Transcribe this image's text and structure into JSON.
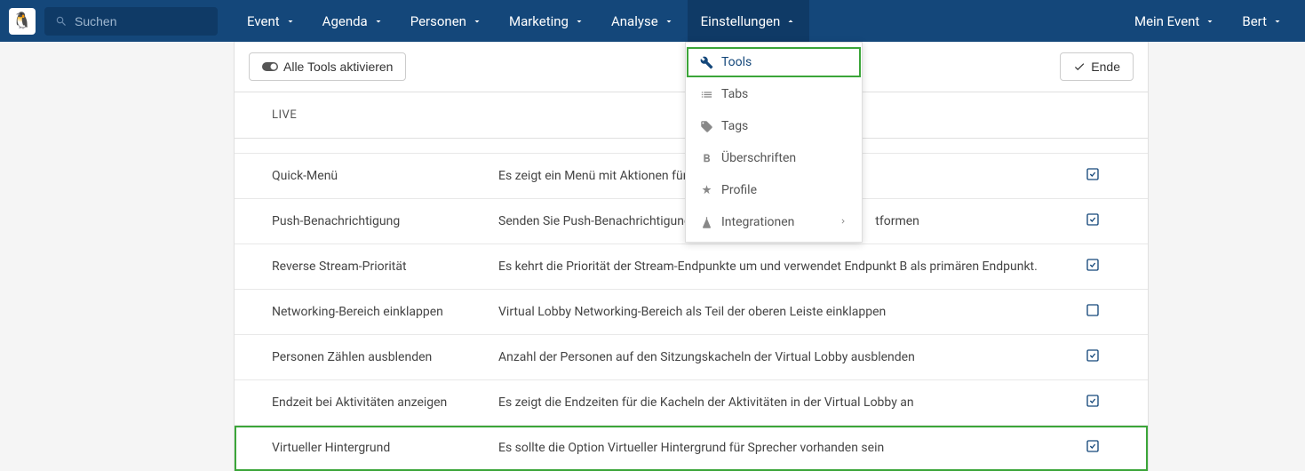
{
  "search": {
    "placeholder": "Suchen"
  },
  "nav": {
    "items": [
      {
        "label": "Event"
      },
      {
        "label": "Agenda"
      },
      {
        "label": "Personen"
      },
      {
        "label": "Marketing"
      },
      {
        "label": "Analyse"
      },
      {
        "label": "Einstellungen"
      }
    ],
    "right": [
      {
        "label": "Mein Event"
      },
      {
        "label": "Bert"
      }
    ]
  },
  "toolbar": {
    "activate_label": "Alle Tools aktivieren",
    "end_label": "Ende"
  },
  "section": {
    "title": "LIVE"
  },
  "dropdown": {
    "items": [
      {
        "label": "Tools",
        "icon": "wrench"
      },
      {
        "label": "Tabs",
        "icon": "list"
      },
      {
        "label": "Tags",
        "icon": "tag"
      },
      {
        "label": "Überschriften",
        "icon": "bold"
      },
      {
        "label": "Profile",
        "icon": "asterisk"
      },
      {
        "label": "Integrationen",
        "icon": "flask",
        "sub": true
      }
    ]
  },
  "faded_row": {
    "desc_fragment": "",
    "link": ""
  },
  "rows": [
    {
      "name": "Quick-Menü",
      "desc": "Es zeigt ein Menü mit Aktionen für d",
      "checked": true
    },
    {
      "name": "Push-Benachrichtigung",
      "desc": "Senden Sie Push-Benachrichtigunge",
      "desc_tail": "tformen",
      "checked": true
    },
    {
      "name": "Reverse Stream-Priorität",
      "desc": "Es kehrt die Priorität der Stream-Endpunkte um und verwendet Endpunkt B als primären Endpunkt.",
      "checked": true
    },
    {
      "name": "Networking-Bereich einklappen",
      "desc": "Virtual Lobby Networking-Bereich als Teil der oberen Leiste einklappen",
      "checked": false
    },
    {
      "name": "Personen Zählen ausblenden",
      "desc": "Anzahl der Personen auf den Sitzungskacheln der Virtual Lobby ausblenden",
      "checked": true
    },
    {
      "name": "Endzeit bei Aktivitäten anzeigen",
      "desc": "Es zeigt die Endzeiten für die Kacheln der Aktivitäten in der Virtual Lobby an",
      "checked": true
    },
    {
      "name": "Virtueller Hintergrund",
      "desc": "Es sollte die Option Virtueller Hintergrund für Sprecher vorhanden sein",
      "checked": true,
      "highlight": true
    }
  ]
}
